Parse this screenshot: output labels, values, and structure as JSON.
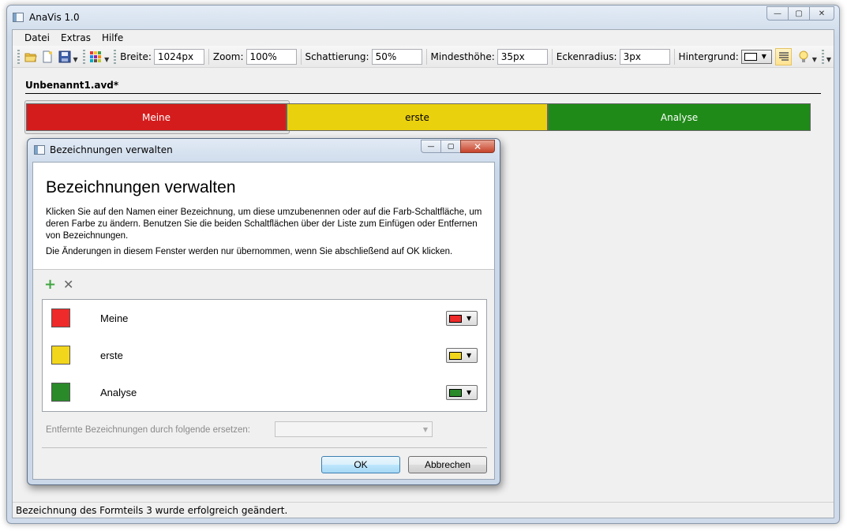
{
  "app": {
    "title": "AnaVis 1.0",
    "window_buttons": {
      "minimize": "—",
      "maximize": "▢",
      "close": "✕"
    }
  },
  "menu": [
    "Datei",
    "Extras",
    "Hilfe"
  ],
  "toolbar": {
    "icons": [
      "open-folder-icon",
      "new-document-icon",
      "save-icon",
      "color-grid-icon",
      "bulb-icon"
    ],
    "fields": [
      {
        "label": "Breite:",
        "value": "1024px"
      },
      {
        "label": "Zoom:",
        "value": "100%"
      },
      {
        "label": "Schattierung:",
        "value": "50%"
      },
      {
        "label": "Mindesthöhe:",
        "value": "35px"
      },
      {
        "label": "Eckenradius:",
        "value": "3px"
      }
    ],
    "background_label": "Hintergrund:",
    "background_color": "#ffffff"
  },
  "document": {
    "title": "Unbenannt1.avd*",
    "bars": [
      {
        "label": "Meine",
        "color": "#d41c1c",
        "text_color": "#ffffff"
      },
      {
        "label": "erste",
        "color": "#ead10e",
        "text_color": "#000000"
      },
      {
        "label": "Analyse",
        "color": "#1f8a18",
        "text_color": "#ffffff"
      }
    ]
  },
  "status": "Bezeichnung des Formteils 3 wurde erfolgreich geändert.",
  "dialog": {
    "title": "Bezeichnungen verwalten",
    "heading": "Bezeichnungen verwalten",
    "paragraph1": "Klicken Sie auf den Namen einer Bezeichnung, um diese umzubenennen oder auf die Farb-Schaltfläche, um deren Farbe zu ändern. Benutzen Sie die beiden Schaltflächen über der Liste zum Einfügen oder Entfernen von Bezeichnungen.",
    "paragraph2": "Die Änderungen in diesem Fenster werden nur übernommen, wenn Sie abschließend auf OK klicken.",
    "add_icon": "+",
    "remove_icon": "✕",
    "items": [
      {
        "name": "Meine",
        "color": "#ee2a2a"
      },
      {
        "name": "erste",
        "color": "#f2d61c"
      },
      {
        "name": "Analyse",
        "color": "#2a8a2a"
      }
    ],
    "replace_label": "Entfernte Bezeichnungen durch folgende ersetzen:",
    "replace_value": "",
    "ok_label": "OK",
    "cancel_label": "Abbrechen"
  }
}
